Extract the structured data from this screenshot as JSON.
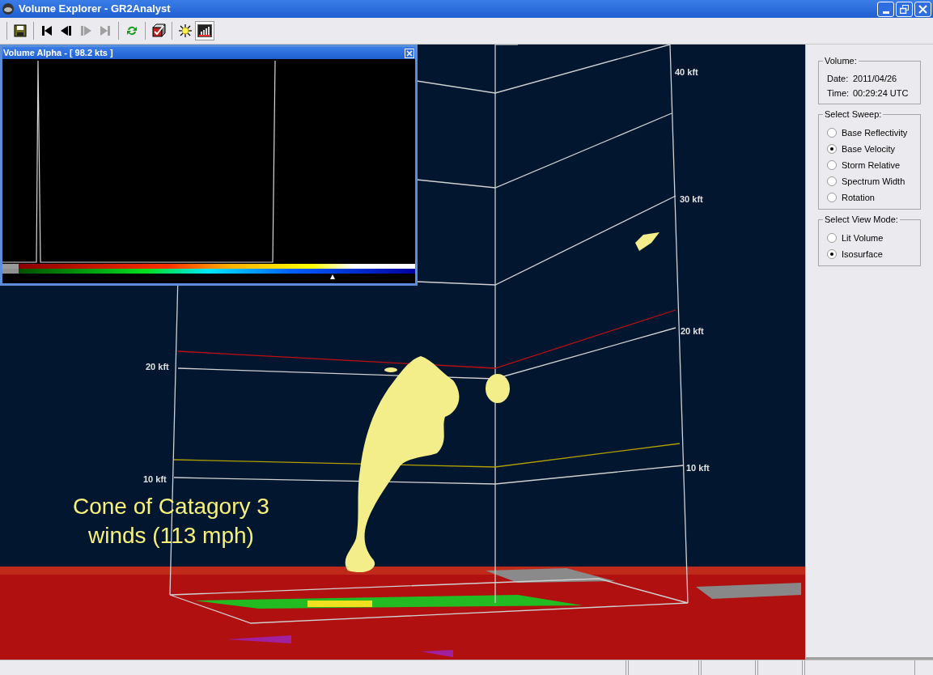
{
  "window": {
    "title": "Volume Explorer - GR2Analyst"
  },
  "toolbar": {
    "groups": [
      [
        {
          "kind": "save",
          "pressed": false
        }
      ],
      [
        {
          "kind": "first",
          "disabled": false,
          "pressed": false
        },
        {
          "kind": "prev",
          "disabled": false,
          "pressed": false
        },
        {
          "kind": "next",
          "disabled": true,
          "pressed": false
        },
        {
          "kind": "last",
          "disabled": true,
          "pressed": false
        }
      ],
      [
        {
          "kind": "refresh",
          "pressed": false
        }
      ],
      [
        {
          "kind": "cube",
          "pressed": false
        }
      ],
      [
        {
          "kind": "light",
          "pressed": false
        },
        {
          "kind": "colorbar",
          "pressed": true
        }
      ]
    ]
  },
  "alpha_window": {
    "title": "Volume Alpha - [ 98.2 kts ]",
    "level": 0.8
  },
  "scene": {
    "height_labels": [
      "40 kft",
      "30 kft",
      "20 kft",
      "20 kft",
      "10 kft",
      "10 kft"
    ],
    "annotation": [
      "Cone of Catagory 3",
      "winds (113 mph)"
    ]
  },
  "panel": {
    "volume": {
      "title": "Volume:",
      "rows": [
        {
          "label": "Date:",
          "value": "2011/04/26"
        },
        {
          "label": "Time:",
          "value": "00:29:24 UTC"
        }
      ]
    },
    "sweep": {
      "title": "Select Sweep:",
      "options": [
        {
          "label": "Base Reflectivity",
          "selected": false
        },
        {
          "label": "Base Velocity",
          "selected": true
        },
        {
          "label": "Storm Relative",
          "selected": false
        },
        {
          "label": "Spectrum Width",
          "selected": false
        },
        {
          "label": "Rotation",
          "selected": false
        }
      ]
    },
    "view_mode": {
      "title": "Select View Mode:",
      "options": [
        {
          "label": "Lit Volume",
          "selected": false
        },
        {
          "label": "Isosurface",
          "selected": true
        }
      ]
    }
  }
}
